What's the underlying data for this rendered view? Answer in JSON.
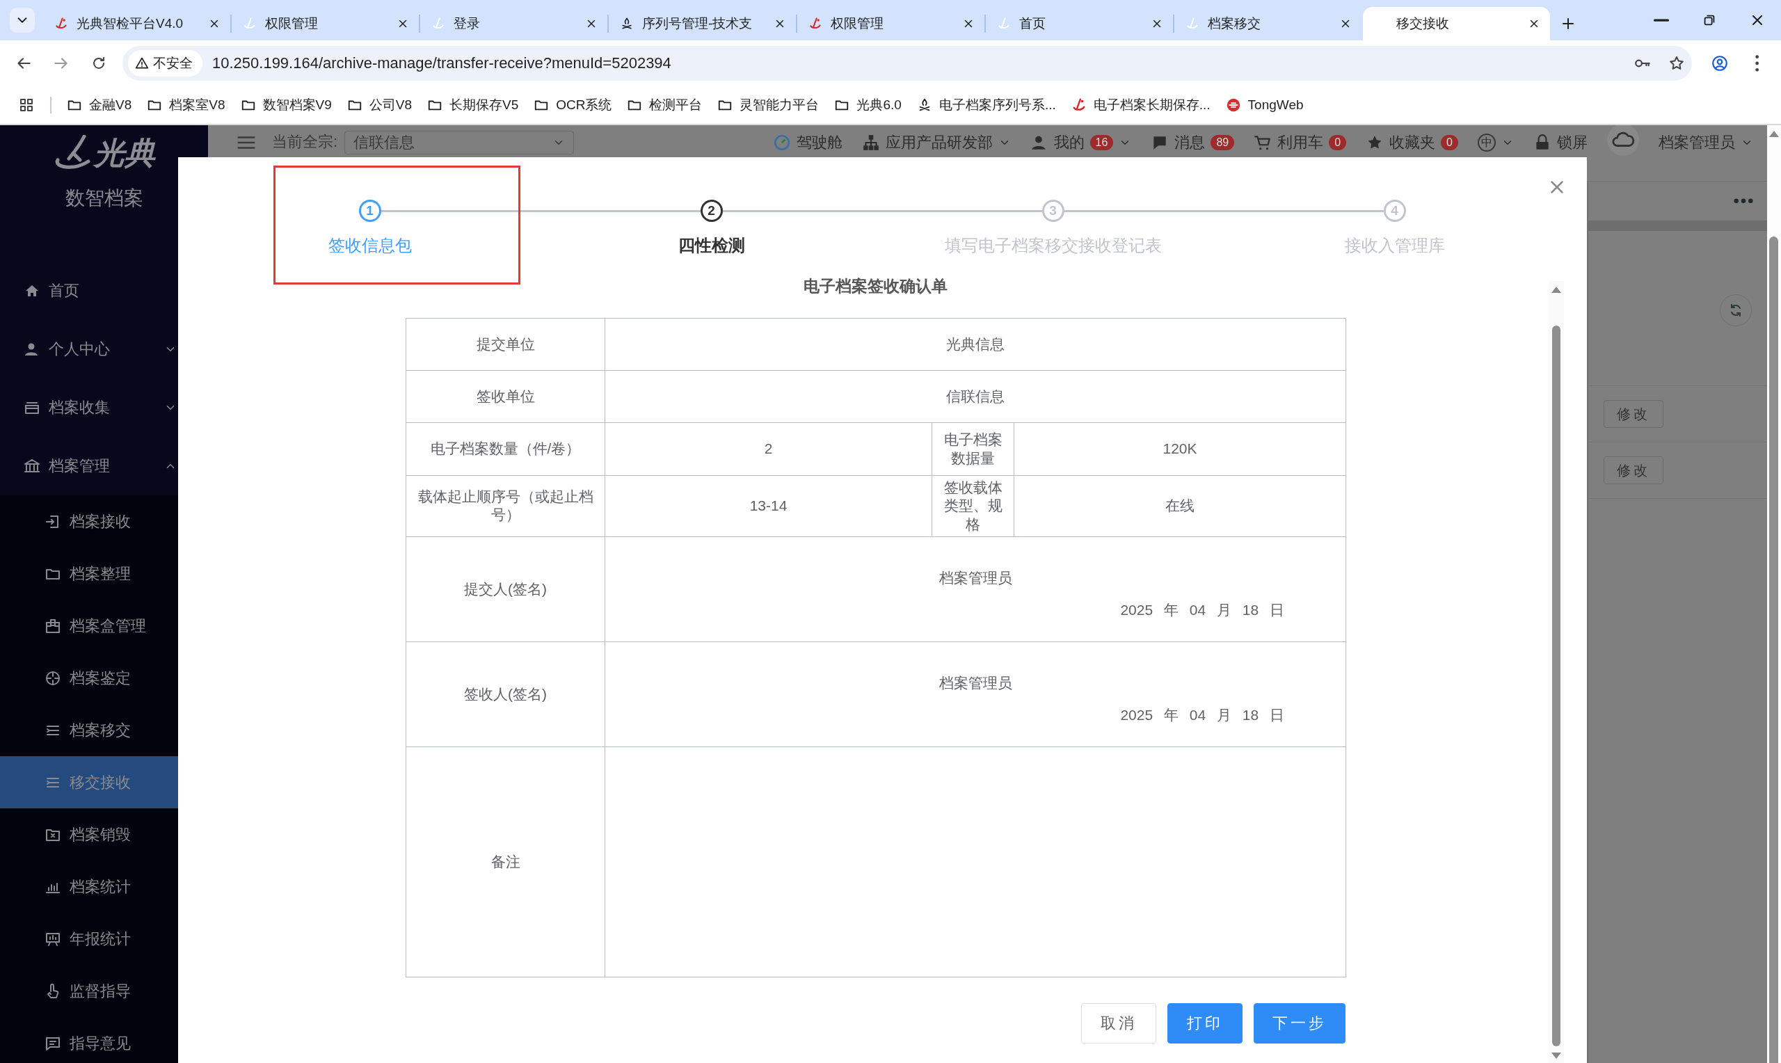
{
  "browser": {
    "tabs": [
      {
        "title": "光典智检平台V4.0",
        "kind": "brand",
        "selected": false
      },
      {
        "title": "权限管理",
        "kind": "ghost",
        "selected": false
      },
      {
        "title": "登录",
        "kind": "ghost",
        "selected": false
      },
      {
        "title": "序列号管理-技术支",
        "kind": "camp",
        "selected": false
      },
      {
        "title": "权限管理",
        "kind": "brand",
        "selected": false
      },
      {
        "title": "首页",
        "kind": "ghost",
        "selected": false
      },
      {
        "title": "档案移交",
        "kind": "ghost",
        "selected": false
      },
      {
        "title": "移交接收",
        "kind": "plain",
        "selected": true
      }
    ],
    "security_label": "不安全",
    "url": "10.250.199.164/archive-manage/transfer-receive?menuId=5202394",
    "bookmarks": [
      {
        "label": "金融V8",
        "kind": "folder"
      },
      {
        "label": "档案室V8",
        "kind": "folder"
      },
      {
        "label": "数智档案V9",
        "kind": "folder"
      },
      {
        "label": "公司V8",
        "kind": "folder"
      },
      {
        "label": "长期保存V5",
        "kind": "folder"
      },
      {
        "label": "OCR系统",
        "kind": "folder"
      },
      {
        "label": "检测平台",
        "kind": "folder"
      },
      {
        "label": "灵智能力平台",
        "kind": "folder"
      },
      {
        "label": "光典6.0",
        "kind": "folder"
      },
      {
        "label": "电子档案序列号系...",
        "kind": "camp"
      },
      {
        "label": "电子档案长期保存...",
        "kind": "brand"
      },
      {
        "label": "TongWeb",
        "kind": "web"
      }
    ]
  },
  "sidebar": {
    "brand": "光典",
    "subtitle": "数智档案",
    "items": [
      {
        "label": "首页",
        "kind": "link",
        "selected": false
      },
      {
        "label": "个人中心",
        "kind": "group",
        "selected": false,
        "expanded": false
      },
      {
        "label": "档案收集",
        "kind": "group",
        "selected": false,
        "expanded": false
      },
      {
        "label": "档案管理",
        "kind": "group",
        "selected": false,
        "expanded": true,
        "children": [
          {
            "label": "档案接收",
            "selected": false
          },
          {
            "label": "档案整理",
            "selected": false
          },
          {
            "label": "档案盒管理",
            "selected": false
          },
          {
            "label": "档案鉴定",
            "selected": false
          },
          {
            "label": "档案移交",
            "selected": false
          },
          {
            "label": "移交接收",
            "selected": true
          },
          {
            "label": "档案销毁",
            "selected": false
          },
          {
            "label": "档案统计",
            "selected": false
          },
          {
            "label": "年报统计",
            "selected": false
          },
          {
            "label": "监督指导",
            "selected": false
          },
          {
            "label": "指导意见",
            "selected": false
          }
        ]
      }
    ]
  },
  "header": {
    "fonds_label": "当前全宗:",
    "fonds_value": "信联信息",
    "items": [
      {
        "label": "驾驶舱",
        "kind": "icon",
        "dropdown": false
      },
      {
        "label": "应用产品研发部",
        "kind": "icon",
        "dropdown": true
      },
      {
        "label": "我的",
        "kind": "icon",
        "badge": "16",
        "dropdown": true
      },
      {
        "label": "消息",
        "kind": "icon",
        "badge": "89",
        "dropdown": false
      },
      {
        "label": "利用车",
        "kind": "icon",
        "badge": "0",
        "dropdown": false
      },
      {
        "label": "收藏夹",
        "kind": "icon",
        "badge": "0",
        "dropdown": false
      },
      {
        "label": "中",
        "kind": "circled",
        "dropdown": true
      },
      {
        "label": "锁屏",
        "kind": "icon",
        "dropdown": false
      }
    ],
    "user": "档案管理员"
  },
  "background": {
    "row_actions": [
      "修改",
      "修改"
    ]
  },
  "dialog": {
    "steps": [
      {
        "number": "1",
        "label": "签收信息包",
        "done": true,
        "current": false,
        "highlighted": true
      },
      {
        "number": "2",
        "label": "四性检测",
        "done": false,
        "current": true,
        "highlighted": false
      },
      {
        "number": "3",
        "label": "填写电子档案移交接收登记表",
        "done": false,
        "current": false,
        "highlighted": false
      },
      {
        "number": "4",
        "label": "接收入管理库",
        "done": false,
        "current": false,
        "highlighted": false
      }
    ],
    "form_title": "电子档案签收确认单",
    "rows": [
      {
        "kind": "single",
        "label": "提交单位",
        "value": "光典信息"
      },
      {
        "kind": "single",
        "label": "签收单位",
        "value": "信联信息"
      },
      {
        "kind": "pair",
        "label": "电子档案数量（件/卷）",
        "value": "2",
        "label_2": "电子档案数据量",
        "value_2": "120K"
      },
      {
        "kind": "pair",
        "label": "载体起止顺序号（或起止档号）",
        "value": "13-14",
        "label_2": "签收载体类型、规格",
        "value_2": "在线"
      },
      {
        "kind": "signature",
        "label": "提交人(签名)",
        "value": "档案管理员",
        "date": "2025 年 04 月 18 日"
      },
      {
        "kind": "signature",
        "label": "签收人(签名)",
        "value": "档案管理员",
        "date": "2025 年 04 月 18 日"
      },
      {
        "kind": "remark",
        "label": "备注"
      }
    ],
    "buttons": [
      {
        "label": "取消",
        "kind": "default"
      },
      {
        "label": "打印",
        "kind": "primary"
      },
      {
        "label": "下一步",
        "kind": "primary"
      }
    ]
  }
}
